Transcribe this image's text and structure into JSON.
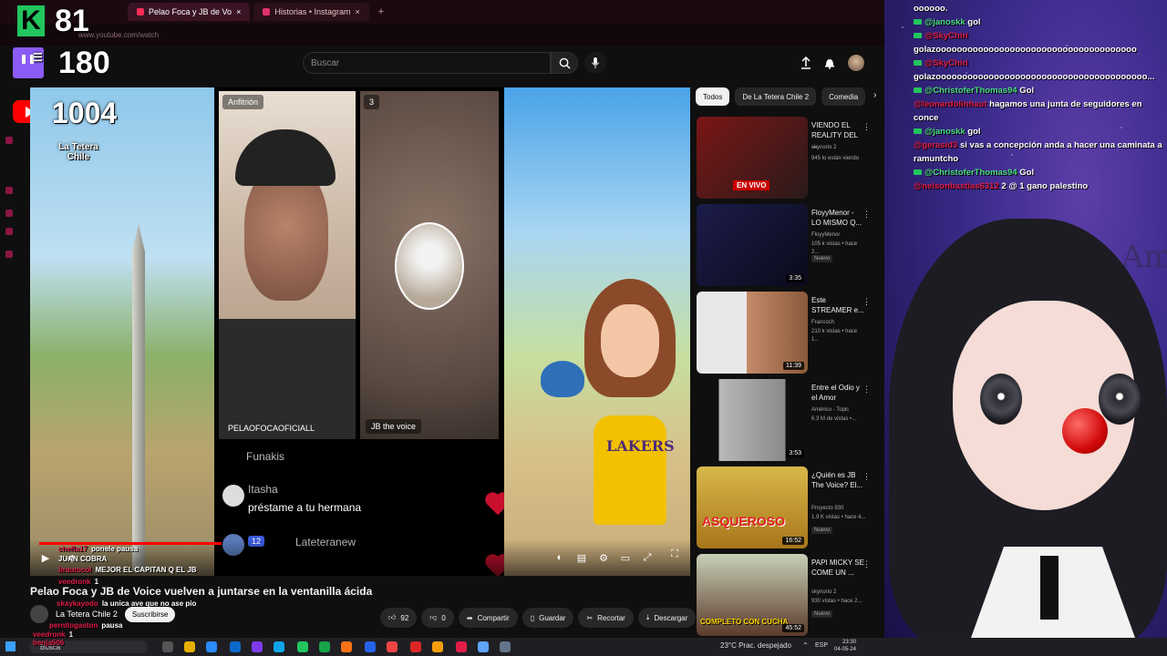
{
  "browser": {
    "tabs": [
      {
        "label": "Pelao Foca y JB de Vo",
        "active": true
      },
      {
        "label": "Historias • Instagram",
        "active": false
      }
    ],
    "url": "www.youtube.com/watch"
  },
  "overlay": {
    "kick_count": "81",
    "twitch_count": "180",
    "youtube_count": "1004",
    "channel_label": "La Tetera Chile"
  },
  "yt_header": {
    "search_placeholder": "Buscar"
  },
  "player": {
    "host_tag": "Anfitrión",
    "guest_count": "3",
    "host_handle": "PELAOFOCAOFICIALL",
    "guest_tag": "JB the voice",
    "feed": [
      {
        "user": "Funakis",
        "msg": ""
      },
      {
        "user": "Itasha",
        "msg": "préstame a tu hermana"
      },
      {
        "user": "Lateteranew",
        "msg": ""
      }
    ],
    "feed_likes": "12",
    "toon_shirt": "LAKERS"
  },
  "player_chat": [
    {
      "user": "chefla17",
      "text": "ponele pausa"
    },
    {
      "user": "JUAN COBRA",
      "text": ""
    },
    {
      "user": "brautocol",
      "text": "MEJOR EL CAPITAN Q EL JB"
    },
    {
      "user": "veedronk",
      "text": "1"
    },
    {
      "user": "skaykayodo",
      "text": "la unica ave que no ase pio"
    },
    {
      "user": "pernitogaston",
      "text": "pausa"
    }
  ],
  "video": {
    "title": "Pelao Foca y JB de Voice vuelven a juntarse en la ventanilla ácida",
    "channel": "La Tetera Chile 2",
    "subscribe": "Suscribirse",
    "likes": "92",
    "dislikes": "0",
    "share": "Compartir",
    "save": "Guardar",
    "clip": "Recortar",
    "download": "Descargar"
  },
  "filter_chips": [
    "Todos",
    "De La Tetera Chile 2",
    "Comedia"
  ],
  "recommendations": [
    {
      "title": "VIENDO EL REALITY DEL ...",
      "channel": "skynorio 2",
      "meta": "945 lo están viendo",
      "duration": "",
      "badge": "EN VIVO",
      "thumb": "#7a1616"
    },
    {
      "title": "FloyyMenor - LO MISMO Q...",
      "channel": "FloyyMenor",
      "meta": "105 k vistas • hace 2...",
      "duration": "3:35",
      "badge": "Nuevo",
      "thumb": "#1c1c4a"
    },
    {
      "title": "Este STREAMER e...",
      "channel": "Francoch",
      "meta": "210 k vistas • hace 1...",
      "duration": "11:39",
      "badge": "",
      "thumb": "#e8e8e8"
    },
    {
      "title": "Entre el Odio y el Amor",
      "channel": "Américo - Topic",
      "meta": "6.3 M de vistas •...",
      "duration": "3:53",
      "badge": "",
      "thumb": "#a8a8a8"
    },
    {
      "title": "¿Quién es JB The Voice? El...",
      "channel": "Proyecto 930",
      "meta": "1.9 K vistas • hace 4...",
      "duration": "16:52",
      "badge": "Nuevo",
      "thumb": "#c9a11a"
    },
    {
      "title": "PAPI MICKY SE COME UN ...",
      "channel": "skynorio 2",
      "meta": "930 vistas • hace 2...",
      "duration": "45:52",
      "badge": "Nuevo",
      "thumb": "#5a3a2a"
    }
  ],
  "rec_thumb_text": {
    "r0": "EN VIVO",
    "r4": "ASQUEROSO",
    "r5": "COMPLETO CON CUCHA"
  },
  "stream_chat": [
    {
      "user": "",
      "text": "oooooo.",
      "color": "green"
    },
    {
      "user": "@janoskk",
      "text": "gol",
      "color": "green"
    },
    {
      "user": "@SkyChiri",
      "text": "golazoooooooooooooooooooooooooooooooooooooo",
      "color": "red"
    },
    {
      "user": "@SkyChiri",
      "text": "golazoooooooooooooooooooooooooooooooooooooooo...",
      "color": "red"
    },
    {
      "user": "@ChristoferThomas94",
      "text": "Gol",
      "color": "green"
    },
    {
      "user": "@leonardolinhaut",
      "text": "hagamos una junta de seguidores en conce",
      "color": "red"
    },
    {
      "user": "@janoskk",
      "text": "gol",
      "color": "green"
    },
    {
      "user": "@gerasid3",
      "text": "si vas a concepción anda a hacer una caminata a ramuntcho",
      "color": "red"
    },
    {
      "user": "@ChristoferThomas94",
      "text": "Gol",
      "color": "green"
    },
    {
      "user": "@nelsonbastias6312",
      "text": "2 @ 1 gano palestino",
      "color": "red"
    }
  ],
  "signature": "Dios Te Am",
  "taskbar": {
    "search": "Busca",
    "weather": "23°C  Prac. despejado",
    "lang": "ESP",
    "time": "23:30",
    "date": "04-05-24"
  },
  "taskbar_chat": [
    {
      "user": "veedronk",
      "text": "1"
    },
    {
      "user": "benja506",
      "text": ""
    }
  ]
}
